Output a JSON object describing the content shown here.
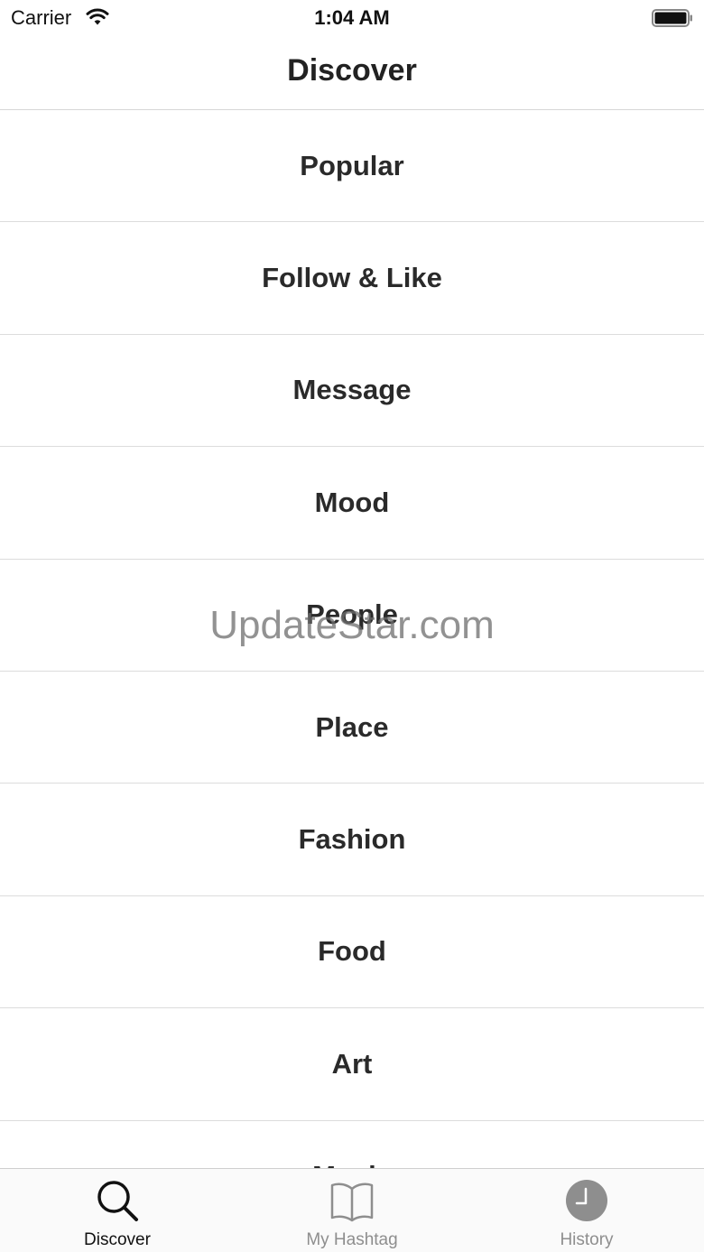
{
  "status_bar": {
    "carrier": "Carrier",
    "time": "1:04 AM"
  },
  "nav": {
    "title": "Discover"
  },
  "list": {
    "items": [
      {
        "label": "Popular"
      },
      {
        "label": "Follow & Like"
      },
      {
        "label": "Message"
      },
      {
        "label": "Mood"
      },
      {
        "label": "People"
      },
      {
        "label": "Place"
      },
      {
        "label": "Fashion"
      },
      {
        "label": "Food"
      },
      {
        "label": "Art"
      },
      {
        "label": "Music"
      }
    ]
  },
  "watermark": "UpdateStar.com",
  "tab_bar": {
    "tabs": [
      {
        "label": "Discover",
        "icon": "search-icon",
        "active": true
      },
      {
        "label": "My Hashtag",
        "icon": "book-icon",
        "active": false
      },
      {
        "label": "History",
        "icon": "clock-icon",
        "active": false
      }
    ]
  },
  "colors": {
    "text": "#222222",
    "separator": "#dcdcdc",
    "tab_inactive": "#8e8e8e",
    "tab_active": "#111111"
  }
}
